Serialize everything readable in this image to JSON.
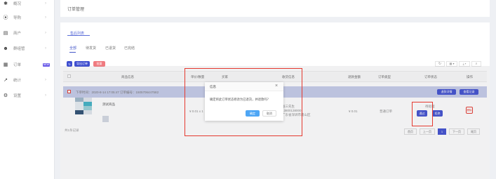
{
  "sidebar": {
    "items": [
      {
        "label": "概况",
        "icon": "dashboard-icon"
      },
      {
        "label": "导购",
        "icon": "guide-icon"
      },
      {
        "label": "商户",
        "icon": "store-icon"
      },
      {
        "label": "群组管",
        "icon": "group-icon"
      },
      {
        "label": "订单",
        "icon": "order-icon",
        "badge": "NEW"
      },
      {
        "label": "统计",
        "icon": "chart-icon"
      },
      {
        "label": "设置",
        "icon": "settings-icon"
      }
    ]
  },
  "page_title": "订单管理",
  "subtab": "售后列表",
  "tabs": [
    "全部",
    "待发货",
    "已退货",
    "已完结"
  ],
  "toolbar": {
    "refresh": "↻",
    "export": "导出订单",
    "batch": "批量",
    "refresh_icon": "↻",
    "columns_icon": "▦ ▾",
    "export_icon": "⤓ ▾",
    "search_icon": "⌕"
  },
  "table": {
    "headers": [
      "商品信息",
      "单价/数量",
      "买家",
      "收货信息",
      "退款金额",
      "订单类型",
      "订单状态",
      "操作"
    ],
    "group_row": "下单时间：2020-8-14 17:05:47    订单编号：1505706447582",
    "group_buttons": [
      "退款详情",
      "查看记录"
    ],
    "product_name": "测试商品",
    "price": "¥ 0.01 x 1",
    "address_lines": [
      "张三先生",
      "13800138000",
      "广东省深圳市南山区"
    ],
    "refund_amount": "¥ 0.01",
    "order_type": "普通订单",
    "order_status": "待处理",
    "action_agree": "通过",
    "action_reject": "拒绝",
    "action_delete": "删除"
  },
  "footer_note": "共1条记录",
  "pagination": {
    "first": "首页",
    "prev": "上一页",
    "current": "1",
    "next": "下一页",
    "last": "尾页"
  },
  "dialog": {
    "title": "信息",
    "message": "确定将此订单状态修改为已退货，并退款吗？",
    "confirm": "确定",
    "cancel": "取消",
    "close": "×"
  },
  "colors": {
    "accent": "#3f4fd0",
    "danger": "#e5392f",
    "confirm": "#4ea6f5"
  }
}
